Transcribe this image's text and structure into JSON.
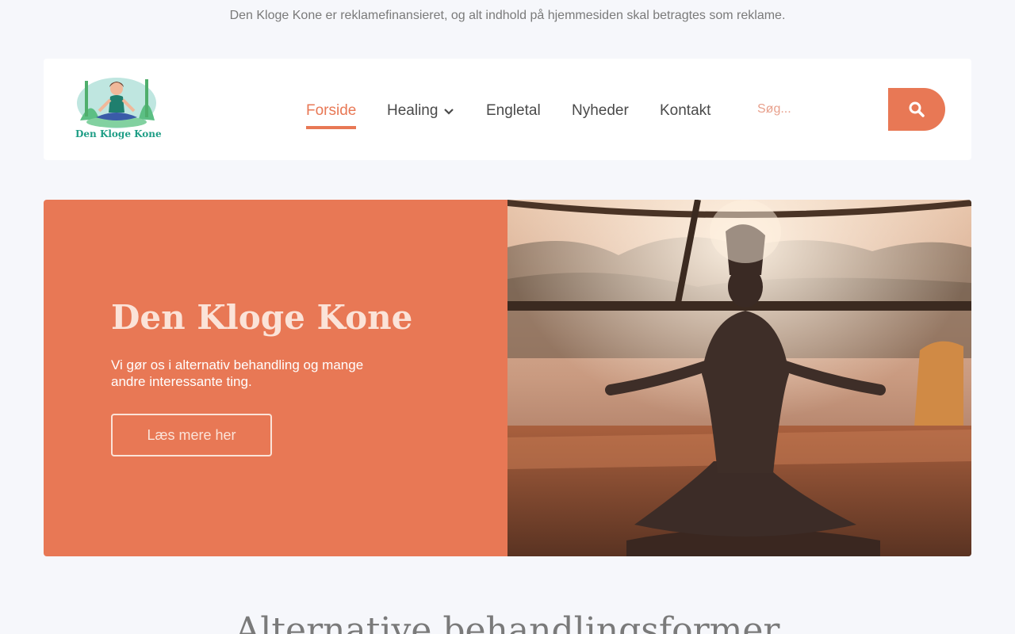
{
  "notice": "Den Kloge Kone er reklamefinansieret, og alt indhold på hjemmesiden skal betragtes som reklame.",
  "logo": {
    "text": "Den Kloge Kone"
  },
  "nav": {
    "items": [
      {
        "label": "Forside",
        "active": true
      },
      {
        "label": "Healing",
        "has_dropdown": true
      },
      {
        "label": "Engletal"
      },
      {
        "label": "Nyheder"
      },
      {
        "label": "Kontakt"
      }
    ]
  },
  "search": {
    "placeholder": "Søg..."
  },
  "hero": {
    "title": "Den Kloge Kone",
    "subtitle": "Vi gør os i alternativ behandling og mange andre interessante ting.",
    "button_label": "Læs mere her",
    "image_icon": "meditation-photo"
  },
  "section": {
    "title": "Alternative behandlingsformer"
  },
  "colors": {
    "accent": "#e87855",
    "background": "#f6f7fb",
    "logo_green": "#1f9e86"
  }
}
